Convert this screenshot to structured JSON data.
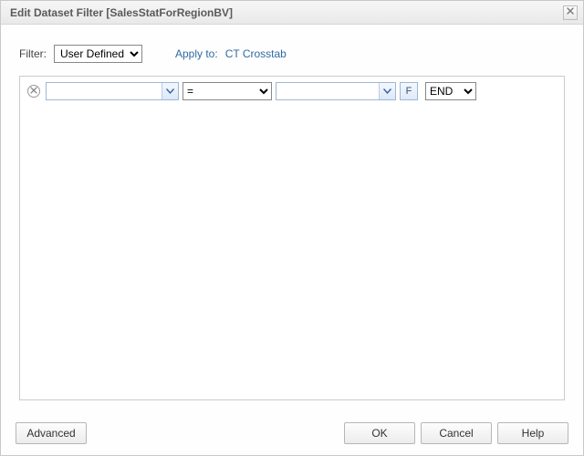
{
  "title": "Edit Dataset Filter [SalesStatForRegionBV]",
  "topbar": {
    "filter_label": "Filter:",
    "filter_options": [
      "User Defined"
    ],
    "filter_value": "User Defined",
    "apply_label": "Apply to:",
    "apply_target": "CT Crosstab"
  },
  "row": {
    "field_value": "",
    "op_options": [
      "="
    ],
    "op_value": "=",
    "value_value": "",
    "f_label": "F",
    "logic_options": [
      "END"
    ],
    "logic_value": "END"
  },
  "footer": {
    "advanced": "Advanced",
    "ok": "OK",
    "cancel": "Cancel",
    "help": "Help"
  }
}
